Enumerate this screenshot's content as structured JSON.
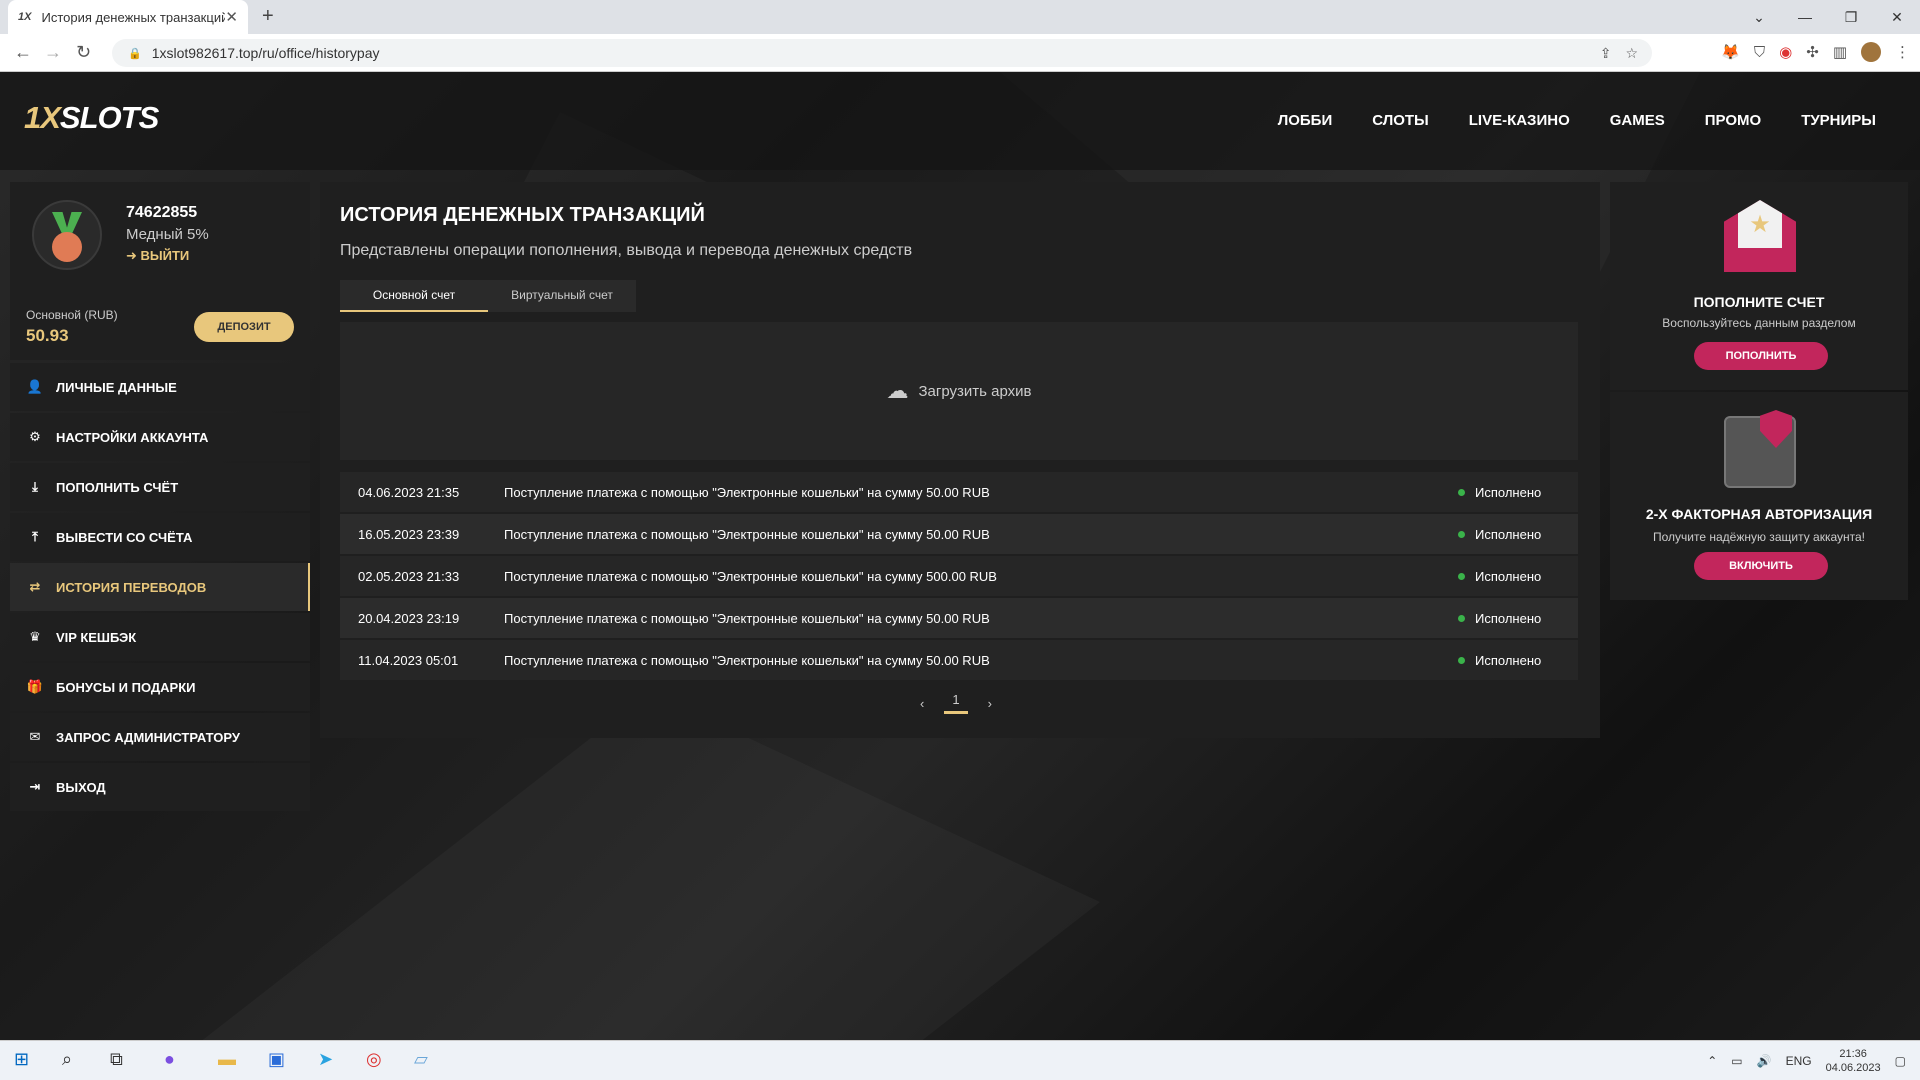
{
  "browser": {
    "tab_title": "История денежных транзакций",
    "tab_favicon": "1X",
    "url": "1xslot982617.top/ru/office/historypay"
  },
  "site": {
    "logo_part1": "1X",
    "logo_part2": "SLOTS",
    "nav": [
      "ЛОББИ",
      "СЛОТЫ",
      "LIVE-КАЗИНО",
      "GAMES",
      "ПРОМО",
      "ТУРНИРЫ"
    ]
  },
  "profile": {
    "id": "74622855",
    "level": "Медный 5%",
    "logout": "ВЫЙТИ",
    "balance_label": "Основной (RUB)",
    "balance_value": "50.93",
    "deposit_button": "ДЕПОЗИТ"
  },
  "sidebar": [
    {
      "label": "ЛИЧНЫЕ ДАННЫЕ",
      "icon": "user-icon",
      "glyph": "👤"
    },
    {
      "label": "НАСТРОЙКИ АККАУНТА",
      "icon": "settings-icon",
      "glyph": "⚙"
    },
    {
      "label": "ПОПОЛНИТЬ СЧЁТ",
      "icon": "download-icon",
      "glyph": "⤓"
    },
    {
      "label": "ВЫВЕСТИ СО СЧЁТА",
      "icon": "upload-icon",
      "glyph": "⤒"
    },
    {
      "label": "ИСТОРИЯ ПЕРЕВОДОВ",
      "icon": "transfer-icon",
      "glyph": "⇄",
      "active": true
    },
    {
      "label": "VIP КЕШБЭК",
      "icon": "crown-icon",
      "glyph": "♛"
    },
    {
      "label": "БОНУСЫ И ПОДАРКИ",
      "icon": "gift-icon",
      "glyph": "🎁"
    },
    {
      "label": "ЗАПРОС АДМИНИСТРАТОРУ",
      "icon": "mail-icon",
      "glyph": "✉"
    },
    {
      "label": "ВЫХОД",
      "icon": "exit-icon",
      "glyph": "⇥"
    }
  ],
  "main": {
    "title": "ИСТОРИЯ ДЕНЕЖНЫХ ТРАНЗАКЦИЙ",
    "subtitle": "Представлены операции пополнения, вывода и перевода денежных средств",
    "tabs": [
      "Основной счет",
      "Виртуальный счет"
    ],
    "archive": "Загрузить архив",
    "transactions": [
      {
        "date": "04.06.2023 21:35",
        "desc": "Поступление платежа с помощью \"Электронные кошельки\" на сумму 50.00 RUB",
        "status": "Исполнено"
      },
      {
        "date": "16.05.2023 23:39",
        "desc": "Поступление платежа с помощью \"Электронные кошельки\" на сумму 50.00 RUB",
        "status": "Исполнено"
      },
      {
        "date": "02.05.2023 21:33",
        "desc": "Поступление платежа с помощью \"Электронные кошельки\" на сумму 500.00 RUB",
        "status": "Исполнено"
      },
      {
        "date": "20.04.2023 23:19",
        "desc": "Поступление платежа с помощью \"Электронные кошельки\" на сумму 50.00 RUB",
        "status": "Исполнено"
      },
      {
        "date": "11.04.2023 05:01",
        "desc": "Поступление платежа с помощью \"Электронные кошельки\" на сумму 50.00 RUB",
        "status": "Исполнено"
      }
    ],
    "page": "1"
  },
  "promo": {
    "deposit_title": "ПОПОЛНИТЕ СЧЕТ",
    "deposit_text": "Воспользуйтесь данным разделом",
    "deposit_button": "ПОПОЛНИТЬ",
    "twofa_title": "2-Х ФАКТОРНАЯ АВТОРИЗАЦИЯ",
    "twofa_text": "Получите надёжную защиту аккаунта!",
    "twofa_button": "ВКЛЮЧИТЬ"
  },
  "taskbar": {
    "lang": "ENG",
    "time": "21:36",
    "date": "04.06.2023"
  },
  "colors": {
    "accent": "#e8c77c",
    "pink": "#c2265c",
    "status_ok": "#3ab34a"
  }
}
